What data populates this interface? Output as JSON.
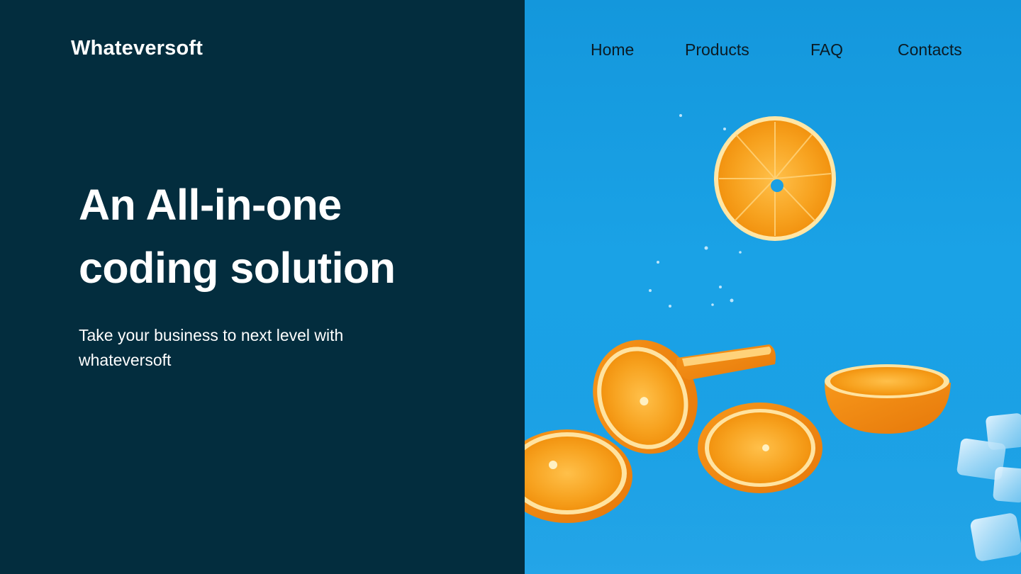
{
  "brand": {
    "logo_text": "Whateversoft"
  },
  "nav": {
    "items": [
      {
        "label": "Home"
      },
      {
        "label": "Products"
      },
      {
        "label": "FAQ"
      },
      {
        "label": "Contacts"
      }
    ]
  },
  "hero": {
    "title_line1": "An All-in-one",
    "title_line2": "coding solution",
    "subtitle": "Take your business to next level with whateversoft"
  },
  "theme": {
    "left_panel_color": "#032d3e",
    "right_panel_color": "#1a9fe3",
    "orange_color": "#f5a623"
  },
  "image": {
    "subject": "orange-slices-on-blue-background-icon"
  }
}
